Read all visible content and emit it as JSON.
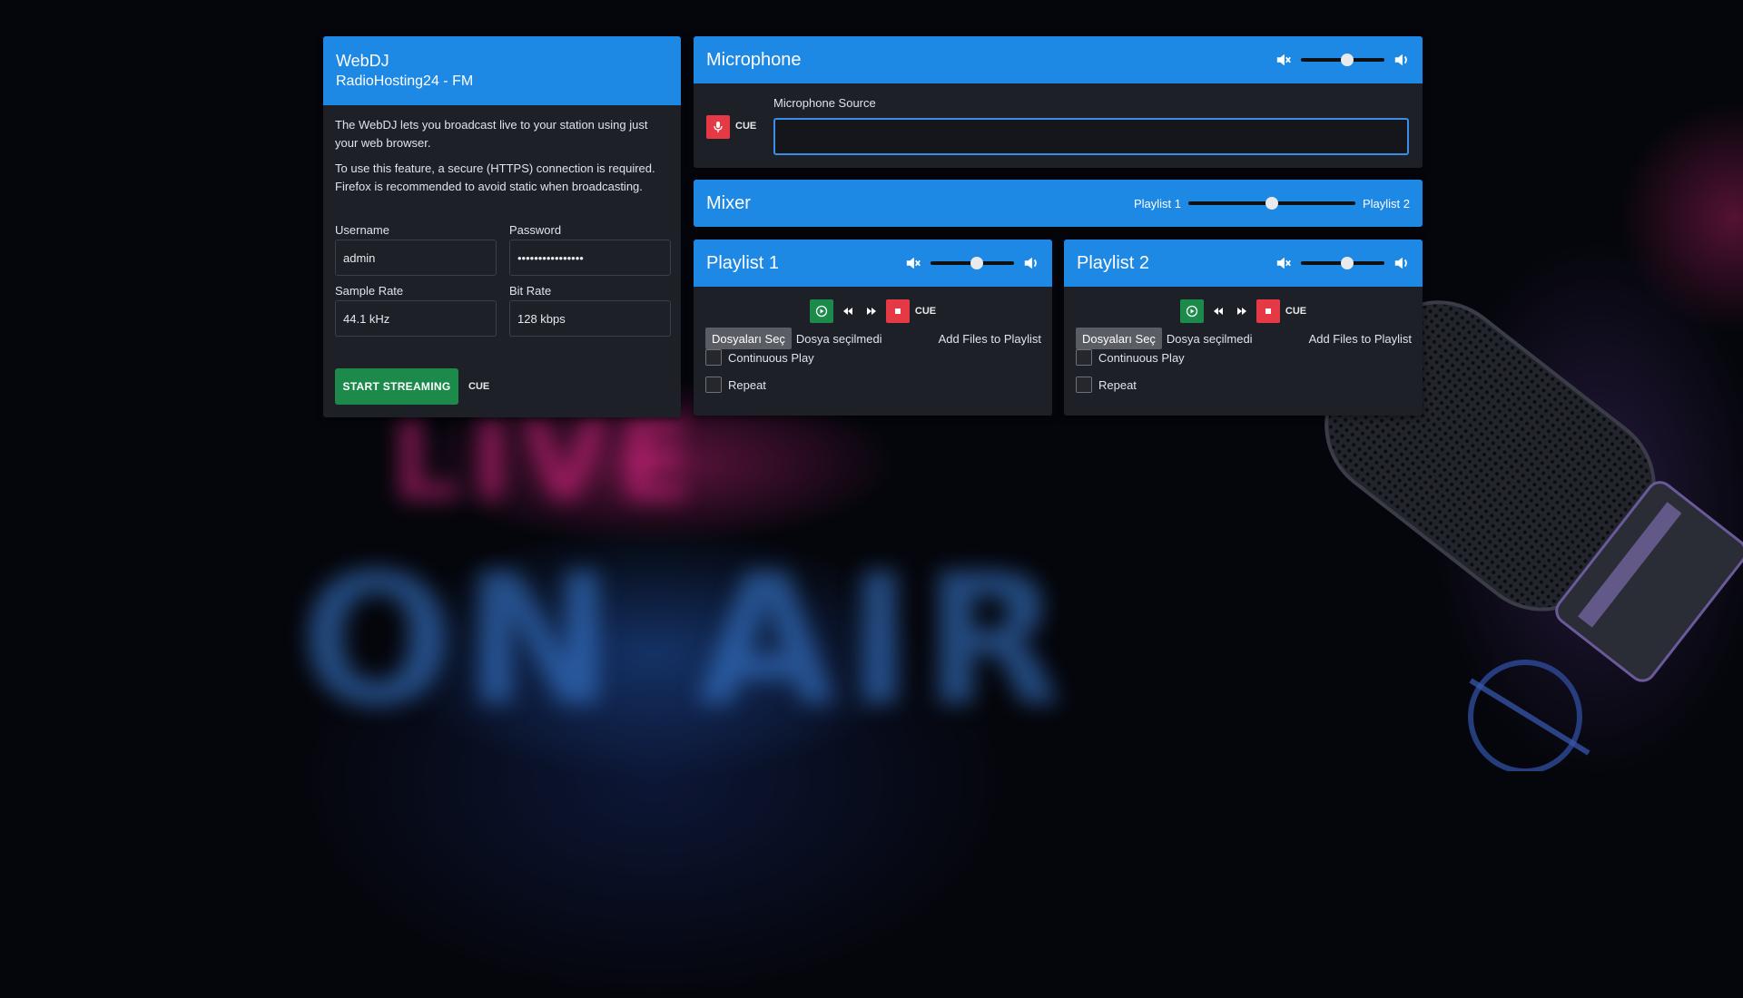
{
  "webdj": {
    "title": "WebDJ",
    "subtitle": "RadioHosting24 - FM",
    "intro": "The WebDJ lets you broadcast live to your station using just your web browser.",
    "notice": "To use this feature, a secure (HTTPS) connection is required. Firefox is recommended to avoid static when broadcasting.",
    "username_label": "Username",
    "username_value": "admin",
    "password_label": "Password",
    "password_value": "••••••••••••••••",
    "sample_rate_label": "Sample Rate",
    "sample_rate_value": "44.1 kHz",
    "bit_rate_label": "Bit Rate",
    "bit_rate_value": "128 kbps",
    "start_button": "START STREAMING",
    "cue_label": "CUE"
  },
  "microphone": {
    "title": "Microphone",
    "cue_label": "CUE",
    "source_label": "Microphone Source",
    "source_value": "",
    "volume": 0.55
  },
  "mixer": {
    "title": "Mixer",
    "left_label": "Playlist 1",
    "right_label": "Playlist 2",
    "position": 0.5
  },
  "playlists": [
    {
      "title": "Playlist 1",
      "volume": 0.55,
      "cue_label": "CUE",
      "choose_files": "Dosyaları Seç",
      "no_file": "Dosya seçilmedi",
      "add_files": "Add Files to Playlist",
      "continuous_play": "Continuous Play",
      "repeat": "Repeat"
    },
    {
      "title": "Playlist 2",
      "volume": 0.55,
      "cue_label": "CUE",
      "choose_files": "Dosyaları Seç",
      "no_file": "Dosya seçilmedi",
      "add_files": "Add Files to Playlist",
      "continuous_play": "Continuous Play",
      "repeat": "Repeat"
    }
  ],
  "background": {
    "sign_line1": "LIVE",
    "sign_line2": "ON AIR"
  },
  "colors": {
    "accent": "#1e88e5",
    "panel": "#1e2027",
    "success": "#1b8a4b",
    "danger": "#e53945"
  },
  "icons": {
    "mute": "volume-mute-icon",
    "volume": "volume-up-icon",
    "mic": "microphone-icon",
    "play": "play-icon",
    "prev": "previous-icon",
    "next": "next-icon",
    "stop": "stop-icon"
  }
}
